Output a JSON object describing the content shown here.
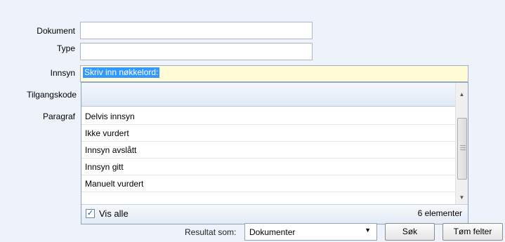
{
  "form": {
    "labels": {
      "dokument": "Dokument",
      "type": "Type",
      "innsyn": "Innsyn",
      "tilgangskode": "Tilgangskode",
      "paragraf": "Paragraf"
    },
    "innsyn_value": "Skriv inn nøkkelord:"
  },
  "dropdown": {
    "items": [
      "Delvis innsyn",
      "Ikke vurdert",
      "Innsyn avslått",
      "Innsyn gitt",
      "Manuelt vurdert"
    ],
    "vis_alle_label": "Vis alle",
    "vis_alle_checked": "✓",
    "count_label": "6 elementer"
  },
  "bottom": {
    "resultat_label": "Resultat som:",
    "resultat_value": "Dokumenter",
    "sok_label": "Søk",
    "tom_label": "Tøm felter"
  }
}
